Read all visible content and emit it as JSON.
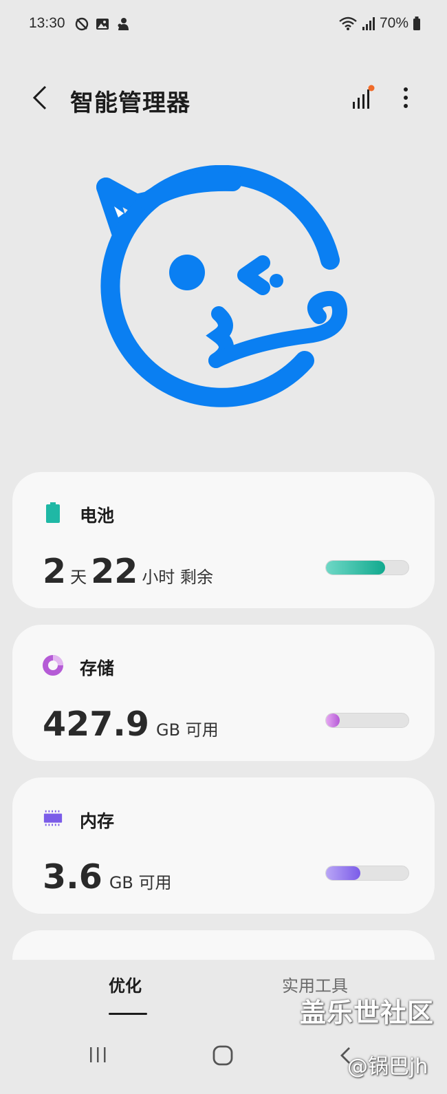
{
  "status_bar": {
    "time": "13:30",
    "battery": "70%",
    "left_icons": [
      "no-location-icon",
      "gallery-icon",
      "app-notification-icon"
    ],
    "right_icons": [
      "wifi-icon",
      "signal-icon",
      "battery-icon"
    ]
  },
  "header": {
    "title": "智能管理器",
    "back_icon": "chevron-left-icon",
    "stats_icon": "bar-chart-icon",
    "more_icon": "more-vertical-icon"
  },
  "cards": {
    "battery": {
      "title": "电池",
      "days": "2",
      "days_unit": "天",
      "hours": "22",
      "hours_unit": "小时 剩余",
      "level_fraction": 0.72,
      "color": "#1fb8a5"
    },
    "storage": {
      "title": "存储",
      "value": "427.9",
      "unit": "GB 可用",
      "used_fraction": 0.17,
      "color": "#b55bd6"
    },
    "memory": {
      "title": "内存",
      "value": "3.6",
      "unit": "GB 可用",
      "used_fraction": 0.42,
      "color": "#7b5ce8"
    }
  },
  "tabs": {
    "optimize": "优化",
    "tools": "实用工具"
  },
  "watermark": {
    "line1": "盖乐世社区",
    "line2": "@锅巴jh"
  },
  "colors": {
    "accent": "#0a7ff2",
    "background": "#e9e9e9",
    "card": "#f8f8f8"
  }
}
